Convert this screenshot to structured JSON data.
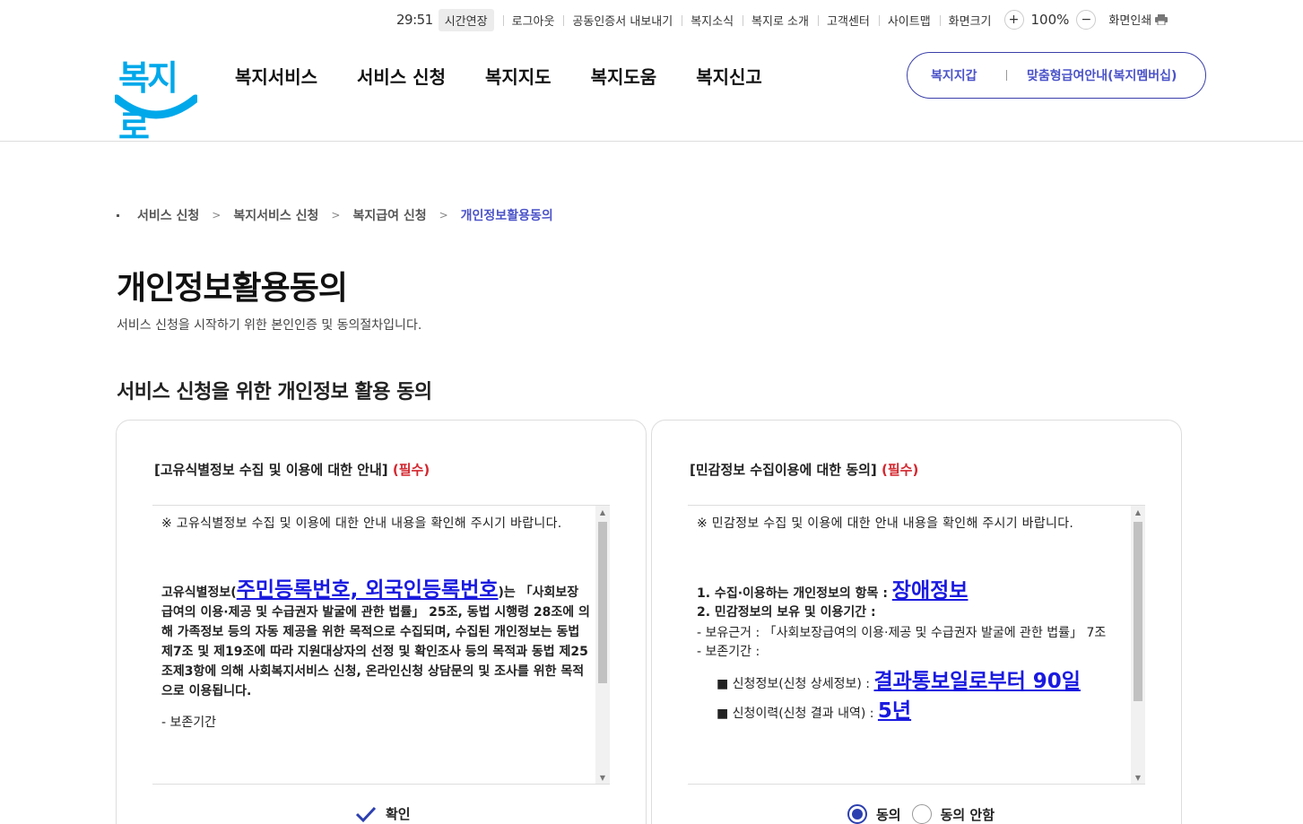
{
  "utility": {
    "timer": "29:51",
    "extend": "시간연장",
    "links": [
      "로그아웃",
      "공동인증서 내보내기",
      "복지소식",
      "복지로 소개",
      "고객센터",
      "사이트맵",
      "화면크기"
    ],
    "zoom_in": "+",
    "zoom": "100%",
    "zoom_out": "−",
    "print": "화면인쇄"
  },
  "logo": {
    "text": "복지로"
  },
  "gnb": [
    "복지서비스",
    "서비스 신청",
    "복지지도",
    "복지도움",
    "복지신고"
  ],
  "pill": {
    "a": "복지지갑",
    "b": "맞춤형급여안내(복지멤버십)"
  },
  "breadcrumb": {
    "items": [
      "서비스 신청",
      "복지서비스 신청",
      "복지급여 신청"
    ],
    "current": "개인정보활용동의"
  },
  "page": {
    "title": "개인정보활용동의",
    "desc": "서비스 신청을 시작하기 위한 본인인증 및 동의절차입니다.",
    "section": "서비스 신청을 위한 개인정보 활용 동의"
  },
  "left": {
    "title": "[고유식별정보 수집 및 이용에 대한 안내]",
    "req": "(필수)",
    "note": "※ 고유식별정보 수집 및 이용에 대한 안내 내용을 확인해 주시기 바랍니다.",
    "p_pre": "고유식별정보(",
    "p_big": "주민등록번호, 외국인등록번호",
    "p_post": ")는 「사회보장급여의 이용·제공 및 수급권자 발굴에 관한 법률」 25조, 동법 시행령 28조에 의해 가족정보 등의 자동 제공을 위한 목적으로 수집되며, 수집된 개인정보는 동법 제7조 및 제19조에 따라 지원대상자의 선정 및 확인조사 등의 목적과 동법 제25조제3항에 의해 사회복지서비스 신청, 온라인신청 상담문의 및 조사를 위한 목적으로 이용됩니다.",
    "retention": "- 보존기간",
    "confirm": "확인"
  },
  "right": {
    "title": "[민감정보 수집이용에 대한 동의]",
    "req": "(필수)",
    "note": "※ 민감정보 수집 및 이용에 대한 안내 내용을 확인해 주시기 바랍니다.",
    "l1_pre": "1. 수집·이용하는 개인정보의 항목 :",
    "l1_big": "장애정보",
    "l2": "2. 민감정보의 보유 및 이용기간 :",
    "l3": " - 보유근거 : 「사회보장급여의 이용·제공 및 수급권자 발굴에 관한 법률」 7조",
    "l4": " - 보존기간 :",
    "l5_pre": "■ 신청정보(신청 상세정보) :",
    "l5_big": "결과통보일로부터 90일",
    "l6_pre": "■ 신청이력(신청 결과 내역) :",
    "l6_big": "5년",
    "agree": "동의",
    "disagree": "동의 안함"
  }
}
